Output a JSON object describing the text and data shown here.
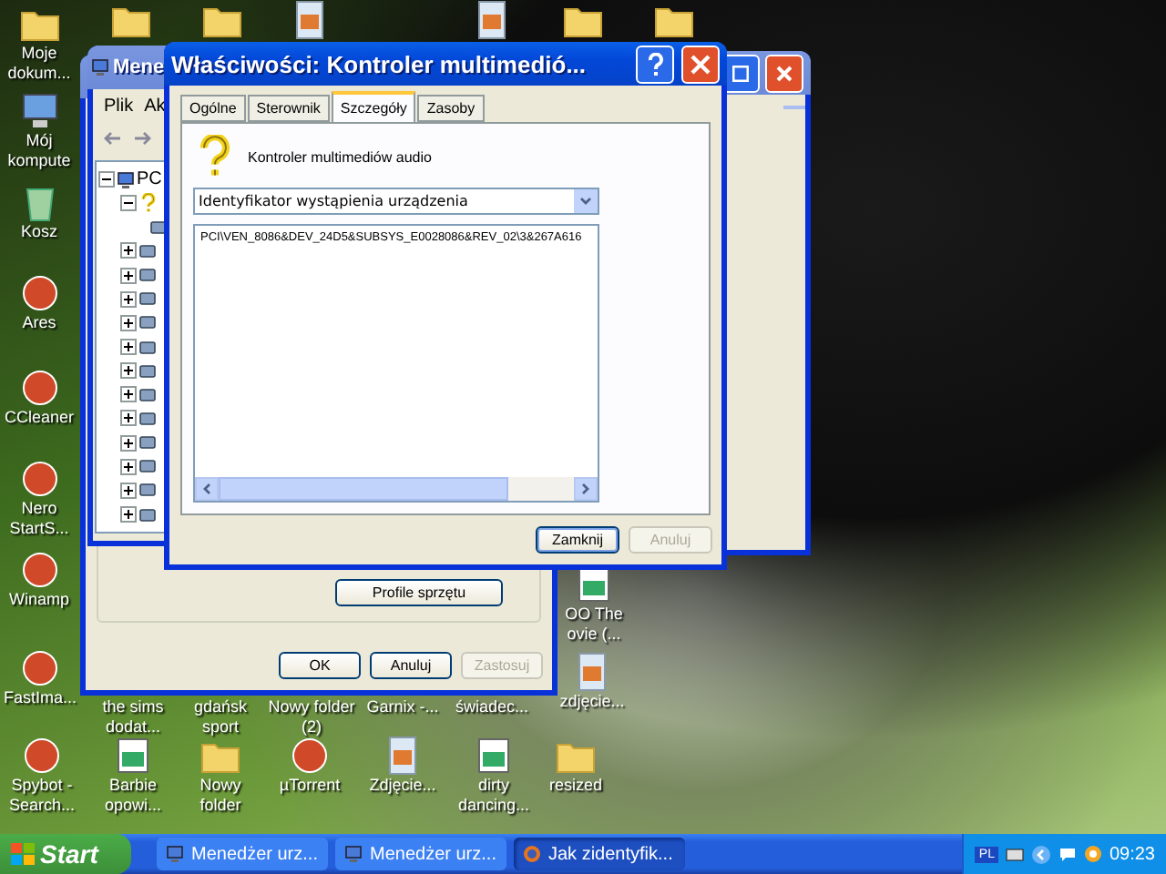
{
  "desktop_icons": [
    {
      "kind": "folder",
      "label": "Moje dokum..."
    },
    {
      "kind": "computer",
      "label": "Mój kompute"
    },
    {
      "kind": "recycle-bin",
      "label": "Kosz"
    },
    {
      "kind": "app",
      "label": "Ares"
    },
    {
      "kind": "app",
      "label": "CCleaner"
    },
    {
      "kind": "app",
      "label": "Nero StartS..."
    },
    {
      "kind": "app",
      "label": "Winamp"
    },
    {
      "kind": "app",
      "label": "FastIma..."
    },
    {
      "label": "the sims dodat..."
    },
    {
      "label": "gdańsk sport"
    },
    {
      "label": "Nowy folder (2)"
    },
    {
      "label": "Garnix -..."
    },
    {
      "label": "świadec..."
    },
    {
      "kind": "video",
      "label": "OO The ovie (..."
    },
    {
      "kind": "image",
      "label": "zdjęcie..."
    },
    {
      "kind": "app",
      "label": "Spybot - Search..."
    },
    {
      "kind": "video",
      "label": "Barbie opowi..."
    },
    {
      "kind": "folder",
      "label": "Nowy folder"
    },
    {
      "kind": "app",
      "label": "µTorrent"
    },
    {
      "kind": "image",
      "label": "Zdjęcie..."
    },
    {
      "kind": "video",
      "label": "dirty dancing..."
    },
    {
      "kind": "folder",
      "label": "resized"
    },
    {
      "kind": "folder"
    },
    {
      "kind": "folder"
    },
    {
      "kind": "image"
    },
    {
      "kind": "image"
    },
    {
      "kind": "folder"
    },
    {
      "kind": "folder"
    }
  ],
  "device_manager": {
    "title": "Mene",
    "menu": [
      "Plik",
      "Ak"
    ],
    "tree": {
      "label": "PC",
      "expanded": true,
      "children": [
        {
          "expanded": true
        },
        {
          "expanded": false
        },
        {
          "expanded": false
        },
        {
          "expanded": false
        },
        {
          "expanded": false
        },
        {
          "expanded": false
        },
        {
          "expanded": false
        },
        {
          "expanded": false
        },
        {
          "expanded": false
        },
        {
          "expanded": false
        },
        {
          "expanded": false
        },
        {
          "expanded": false
        },
        {
          "expanded": false
        }
      ]
    }
  },
  "system_properties": {
    "group_button": "Profile sprzętu",
    "buttons": [
      {
        "label": "OK",
        "disabled": false
      },
      {
        "label": "Anuluj",
        "disabled": false
      },
      {
        "label": "Zastosuj",
        "disabled": true
      }
    ]
  },
  "dialog": {
    "title": "Właściwości: Kontroler multimedió...",
    "tabs": [
      {
        "label": "Ogólne",
        "selected": false
      },
      {
        "label": "Sterownik",
        "selected": false
      },
      {
        "label": "Szczegóły",
        "selected": true
      },
      {
        "label": "Zasoby",
        "selected": false
      }
    ],
    "device_name": "Kontroler multimediów audio",
    "property": "Identyfikator wystąpienia urządzenia",
    "values": [
      "PCI\\VEN_8086&DEV_24D5&SUBSYS_E0028086&REV_02\\3&267A616"
    ],
    "buttons": [
      {
        "label": "Zamknij",
        "disabled": false
      },
      {
        "label": "Anuluj",
        "disabled": true
      }
    ]
  },
  "taskbar": {
    "start": "Start",
    "tasks": [
      {
        "label": "Menedżer urz...",
        "selected": false
      },
      {
        "label": "Menedżer urz...",
        "selected": false
      },
      {
        "label": "Jak zidentyfik...",
        "selected": true
      }
    ],
    "language": "PL",
    "clock": "09:23"
  }
}
